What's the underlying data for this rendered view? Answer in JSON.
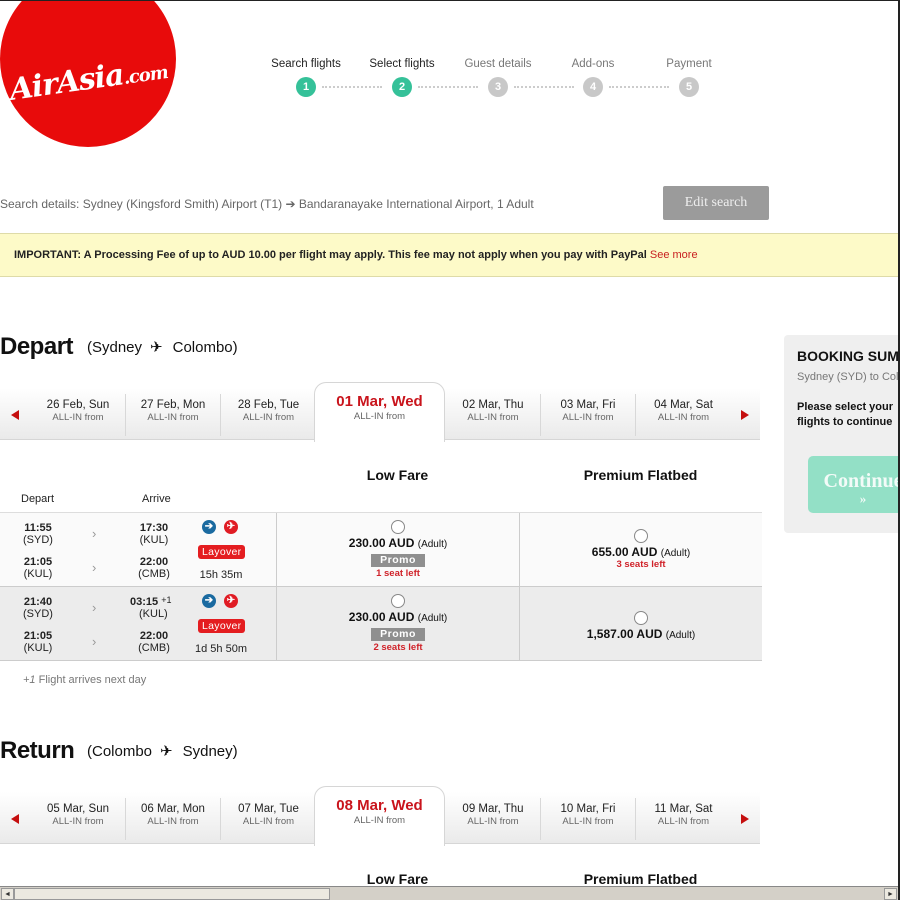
{
  "brand": {
    "logo_text": "AirAsia",
    "logo_suffix": ".com",
    "brand_color": "#e80b0b"
  },
  "progress": {
    "steps": [
      {
        "label": "Search flights",
        "num": "1",
        "state": "done"
      },
      {
        "label": "Select flights",
        "num": "2",
        "state": "active"
      },
      {
        "label": "Guest details",
        "num": "3",
        "state": "pending"
      },
      {
        "label": "Add-ons",
        "num": "4",
        "state": "pending"
      },
      {
        "label": "Payment",
        "num": "5",
        "state": "pending"
      }
    ],
    "active_color": "#35c199"
  },
  "search": {
    "details": "Search details: Sydney (Kingsford Smith) Airport (T1) ➔ Bandaranayake International Airport, 1 Adult",
    "edit_label": "Edit search"
  },
  "notice": {
    "text": "IMPORTANT: A Processing Fee of up to AUD 10.00 per flight may apply. This fee may not apply when you pay with PayPal ",
    "link": "See more"
  },
  "depart": {
    "title": "Depart",
    "route_from": "(Sydney",
    "route_to": "Colombo)",
    "plane_glyph": "✈",
    "dates": [
      {
        "date": "26 Feb, Sun",
        "sub": "ALL-IN from"
      },
      {
        "date": "27 Feb, Mon",
        "sub": "ALL-IN from"
      },
      {
        "date": "28 Feb, Tue",
        "sub": "ALL-IN from"
      },
      {
        "date": "01 Mar, Wed",
        "sub": "ALL-IN from",
        "selected": true
      },
      {
        "date": "02 Mar, Thu",
        "sub": "ALL-IN from"
      },
      {
        "date": "03 Mar, Fri",
        "sub": "ALL-IN from"
      },
      {
        "date": "04 Mar, Sat",
        "sub": "ALL-IN from"
      }
    ],
    "columns": {
      "depart": "Depart",
      "arrive": "Arrive",
      "low_fare": "Low Fare",
      "premium": "Premium Flatbed"
    },
    "flights": [
      {
        "legs": [
          {
            "dep_time": "11:55",
            "dep_apt": "(SYD)",
            "arr_time": "17:30",
            "arr_apt": "(KUL)",
            "next_day": ""
          },
          {
            "dep_time": "21:05",
            "dep_apt": "(KUL)",
            "arr_time": "22:00",
            "arr_apt": "(CMB)",
            "next_day": ""
          }
        ],
        "layover": "Layover",
        "duration": "15h 35m",
        "low_fare": {
          "price": "230.00 AUD",
          "pax": "(Adult)",
          "badge": "Promo",
          "seats": "1 seat left"
        },
        "premium": {
          "price": "655.00 AUD",
          "pax": "(Adult)",
          "seats": "3 seats left"
        }
      },
      {
        "legs": [
          {
            "dep_time": "21:40",
            "dep_apt": "(SYD)",
            "arr_time": "03:15",
            "arr_apt": "(KUL)",
            "next_day": "+1"
          },
          {
            "dep_time": "21:05",
            "dep_apt": "(KUL)",
            "arr_time": "22:00",
            "arr_apt": "(CMB)",
            "next_day": ""
          }
        ],
        "layover": "Layover",
        "duration": "1d 5h 50m",
        "low_fare": {
          "price": "230.00 AUD",
          "pax": "(Adult)",
          "badge": "Promo",
          "seats": "2 seats left"
        },
        "premium": {
          "price": "1,587.00 AUD",
          "pax": "(Adult)",
          "seats": ""
        }
      }
    ],
    "note_prefix": "+1",
    "note": " Flight arrives next day"
  },
  "return": {
    "title": "Return",
    "route_from": "(Colombo",
    "route_to": "Sydney)",
    "plane_glyph": "✈",
    "dates": [
      {
        "date": "05 Mar, Sun",
        "sub": "ALL-IN from"
      },
      {
        "date": "06 Mar, Mon",
        "sub": "ALL-IN from"
      },
      {
        "date": "07 Mar, Tue",
        "sub": "ALL-IN from"
      },
      {
        "date": "08 Mar, Wed",
        "sub": "ALL-IN from",
        "selected": true
      },
      {
        "date": "09 Mar, Thu",
        "sub": "ALL-IN from"
      },
      {
        "date": "10 Mar, Fri",
        "sub": "ALL-IN from"
      },
      {
        "date": "11 Mar, Sat",
        "sub": "ALL-IN from"
      }
    ],
    "columns": {
      "low_fare": "Low Fare",
      "premium": "Premium Flatbed"
    }
  },
  "summary": {
    "title": "BOOKING SUMMARY",
    "route": "Sydney (SYD) to Colombo (CMB)",
    "message": "Please select your flights to continue",
    "continue_label": "Continue",
    "continue_arrows": "»"
  },
  "icons": {
    "flight_blue": "➔",
    "flight_red": "✈",
    "chevron": "›",
    "scroll_left": "◄",
    "scroll_right": "►"
  }
}
